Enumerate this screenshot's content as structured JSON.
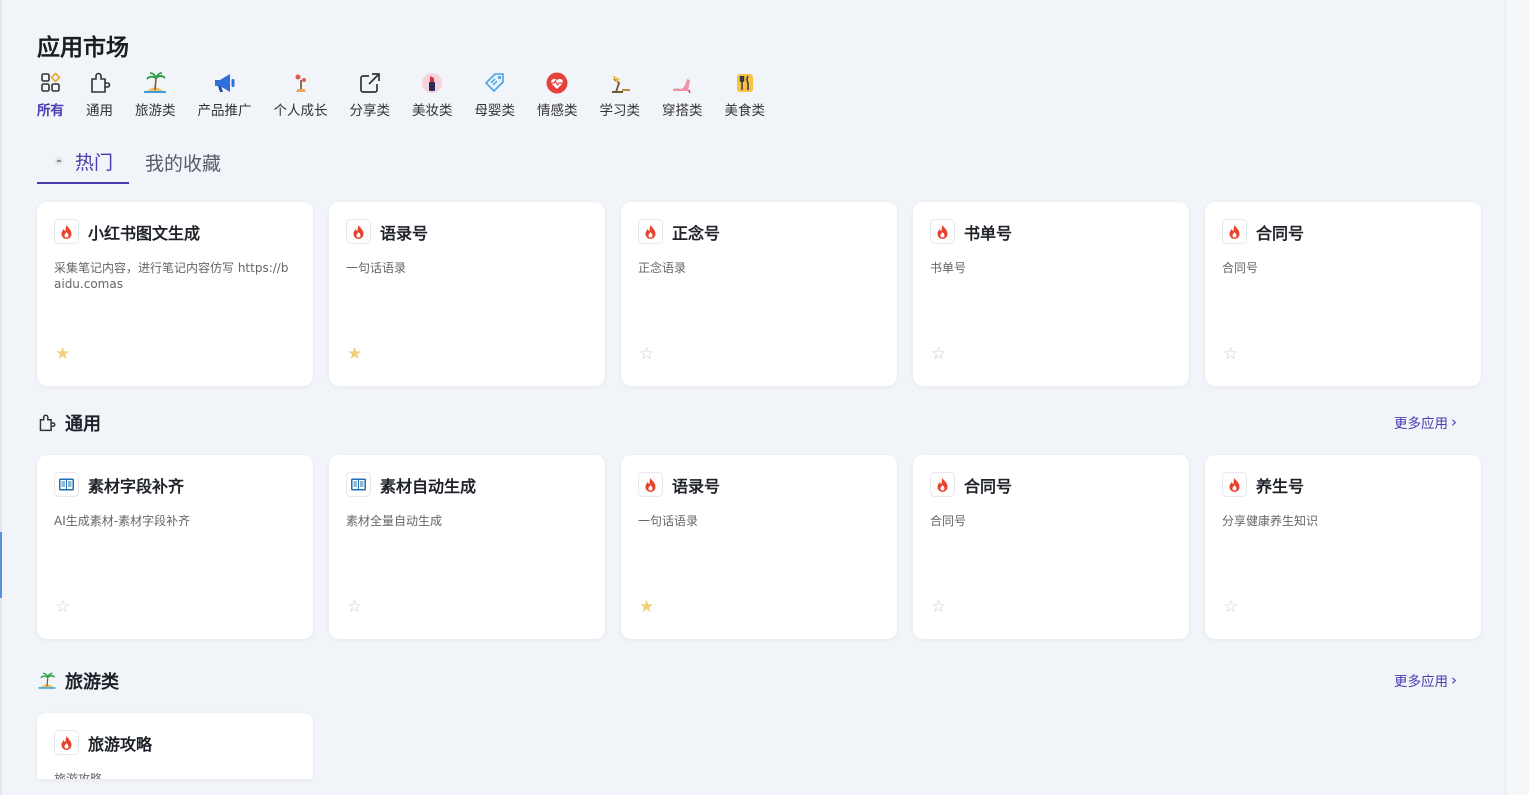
{
  "page": {
    "title": "应用市场"
  },
  "categories": [
    {
      "label": "所有",
      "icon": "grid-icon",
      "active": true
    },
    {
      "label": "通用",
      "icon": "puzzle-icon"
    },
    {
      "label": "旅游类",
      "icon": "island-icon"
    },
    {
      "label": "产品推广",
      "icon": "megaphone-icon"
    },
    {
      "label": "个人成长",
      "icon": "sprout-icon"
    },
    {
      "label": "分享类",
      "icon": "share-icon"
    },
    {
      "label": "美妆类",
      "icon": "lipstick-icon"
    },
    {
      "label": "母婴类",
      "icon": "tag-icon"
    },
    {
      "label": "情感类",
      "icon": "heart-icon"
    },
    {
      "label": "学习类",
      "icon": "lamp-icon"
    },
    {
      "label": "穿搭类",
      "icon": "high-heel-icon"
    },
    {
      "label": "美食类",
      "icon": "cutlery-icon"
    }
  ],
  "tabs": [
    {
      "label": "热门",
      "active": true
    },
    {
      "label": "我的收藏",
      "active": false
    }
  ],
  "hot_cards": [
    {
      "name": "小红书图文生成",
      "desc": "采集笔记内容，进行笔记内容仿写 https://baidu.comas",
      "icon": "flame-icon",
      "starred": true
    },
    {
      "name": "语录号",
      "desc": "一句话语录",
      "icon": "flame-icon",
      "starred": true
    },
    {
      "name": "正念号",
      "desc": "正念语录",
      "icon": "flame-icon",
      "starred": false
    },
    {
      "name": "书单号",
      "desc": "书单号",
      "icon": "flame-icon",
      "starred": false
    },
    {
      "name": "合同号",
      "desc": "合同号",
      "icon": "flame-icon",
      "starred": false
    }
  ],
  "sections": [
    {
      "title": "通用",
      "icon": "puzzle-icon",
      "more_label": "更多应用",
      "cards": [
        {
          "name": "素材字段补齐",
          "desc": "AI生成素材-素材字段补齐",
          "icon": "book-icon",
          "starred": false
        },
        {
          "name": "素材自动生成",
          "desc": "素材全量自动生成",
          "icon": "book-icon",
          "starred": false
        },
        {
          "name": "语录号",
          "desc": "一句话语录",
          "icon": "flame-icon",
          "starred": true
        },
        {
          "name": "合同号",
          "desc": "合同号",
          "icon": "flame-icon",
          "starred": false
        },
        {
          "name": "养生号",
          "desc": "分享健康养生知识",
          "icon": "flame-icon",
          "starred": false
        }
      ]
    },
    {
      "title": "旅游类",
      "icon": "island-icon",
      "more_label": "更多应用",
      "cards": [
        {
          "name": "旅游攻略",
          "desc": "旅游攻略",
          "icon": "flame-icon",
          "starred": false
        }
      ]
    }
  ],
  "star_glyph": "★",
  "star_empty_glyph": "☆",
  "colors": {
    "accent": "#4a3bb0",
    "star_on": "#f2cf7a",
    "flame": "#e8412c"
  }
}
